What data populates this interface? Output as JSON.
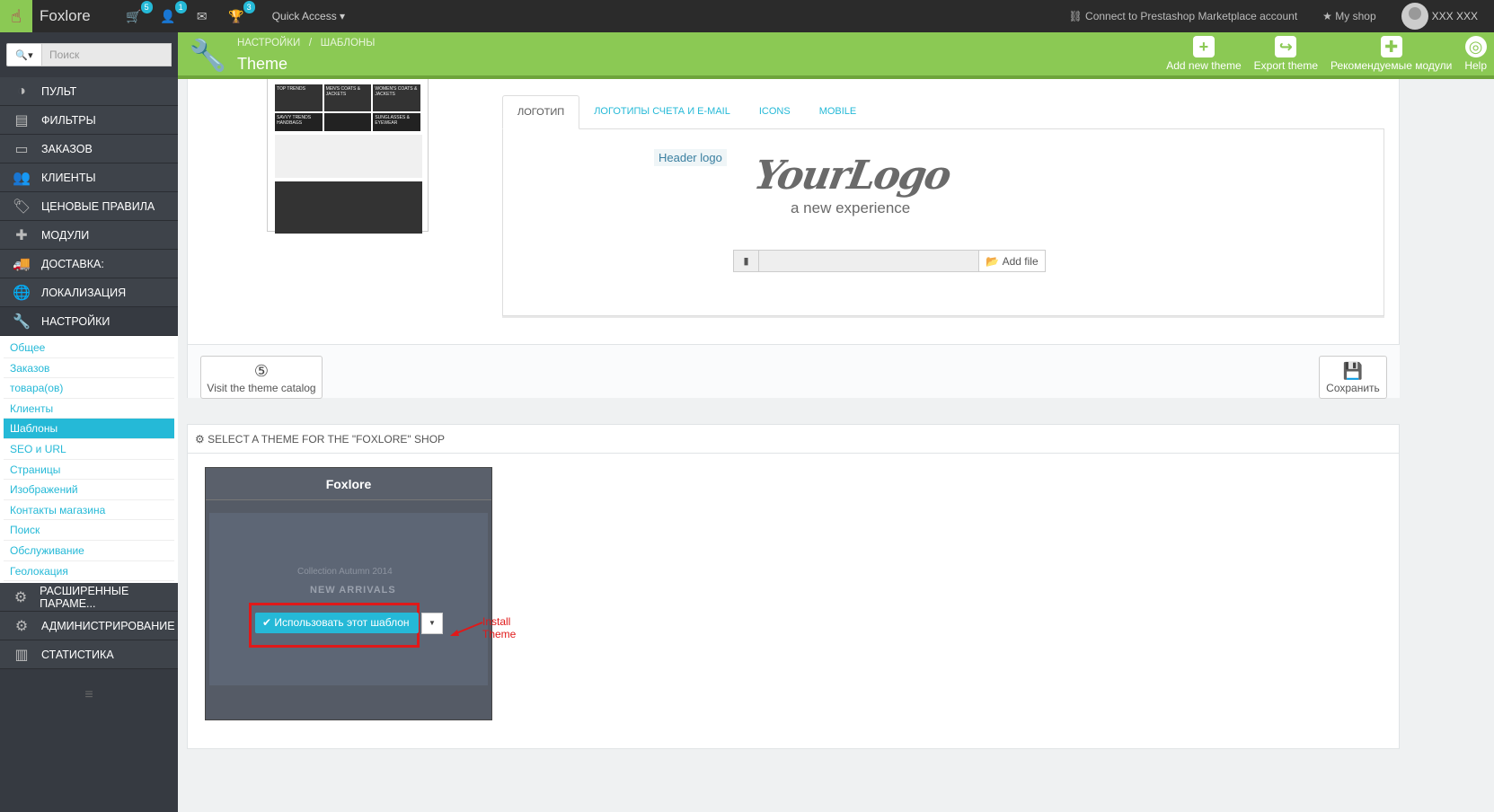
{
  "topbar": {
    "brand": "Foxlore",
    "cart_badge": "5",
    "user_badge": "1",
    "trophy_badge": "3",
    "quick_access": "Quick Access",
    "connect": "Connect to Prestashop Marketplace account",
    "my_shop": "My shop",
    "user": "XXX XXX"
  },
  "sidebar": {
    "search_placeholder": "Поиск",
    "menu": [
      "ПУЛЬТ",
      "ФИЛЬТРЫ",
      "ЗАКАЗОВ",
      "КЛИЕНТЫ",
      "ЦЕНОВЫЕ ПРАВИЛА",
      "МОДУЛИ",
      "ДОСТАВКА:",
      "ЛОКАЛИЗАЦИЯ",
      "НАСТРОЙКИ"
    ],
    "sub": [
      "Общее",
      "Заказов",
      "товара(ов)",
      "Клиенты",
      "Шаблоны",
      "SEO и URL",
      "Страницы",
      "Изображений",
      "Контакты магазина",
      "Поиск",
      "Обслуживание",
      "Геолокация"
    ],
    "menu2": [
      "РАСШИРЕННЫЕ ПАРАМЕ...",
      "АДМИНИСТРИРОВАНИЕ",
      "СТАТИСТИКА"
    ]
  },
  "header": {
    "crumb1": "НАСТРОЙКИ",
    "crumb_sep": "/",
    "crumb2": "ШАБЛОНЫ",
    "title": "Theme",
    "actions": [
      "Add new theme",
      "Export theme",
      "Рекомендуемые модули",
      "Help"
    ]
  },
  "logo_panel": {
    "tabs": [
      "ЛОГОТИП",
      "ЛОГОТИПЫ СЧЕТА И E-MAIL",
      "ICONS",
      "MOBILE"
    ],
    "header_logo_label": "Header logo",
    "logo_text": "YourLogo",
    "logo_sub": "a new experience",
    "add_file": "Add file",
    "visit_catalog": "Visit the theme catalog",
    "save": "Сохранить",
    "preview_tiles": [
      "TOP TRENDS",
      "MEN'S COATS & JACKETS",
      "WOMEN'S COATS & JACKETS",
      "SAVVY TRENDS HANDBAGS",
      "",
      "SUNGLASSES & EYEWEAR"
    ]
  },
  "theme_panel": {
    "heading": "SELECT A THEME FOR THE \"FOXLORE\" SHOP",
    "theme_name": "Foxlore",
    "collection": "Collection Autumn 2014",
    "new_arrivals": "NEW ARRIVALS",
    "use_button": "Использовать этот шаблон",
    "annotation": "Install Theme"
  },
  "colors": {
    "accent": "#25b9d7",
    "header_green": "#8bc954",
    "sidebar_bg": "#363a41",
    "annotation_red": "#e01919"
  }
}
